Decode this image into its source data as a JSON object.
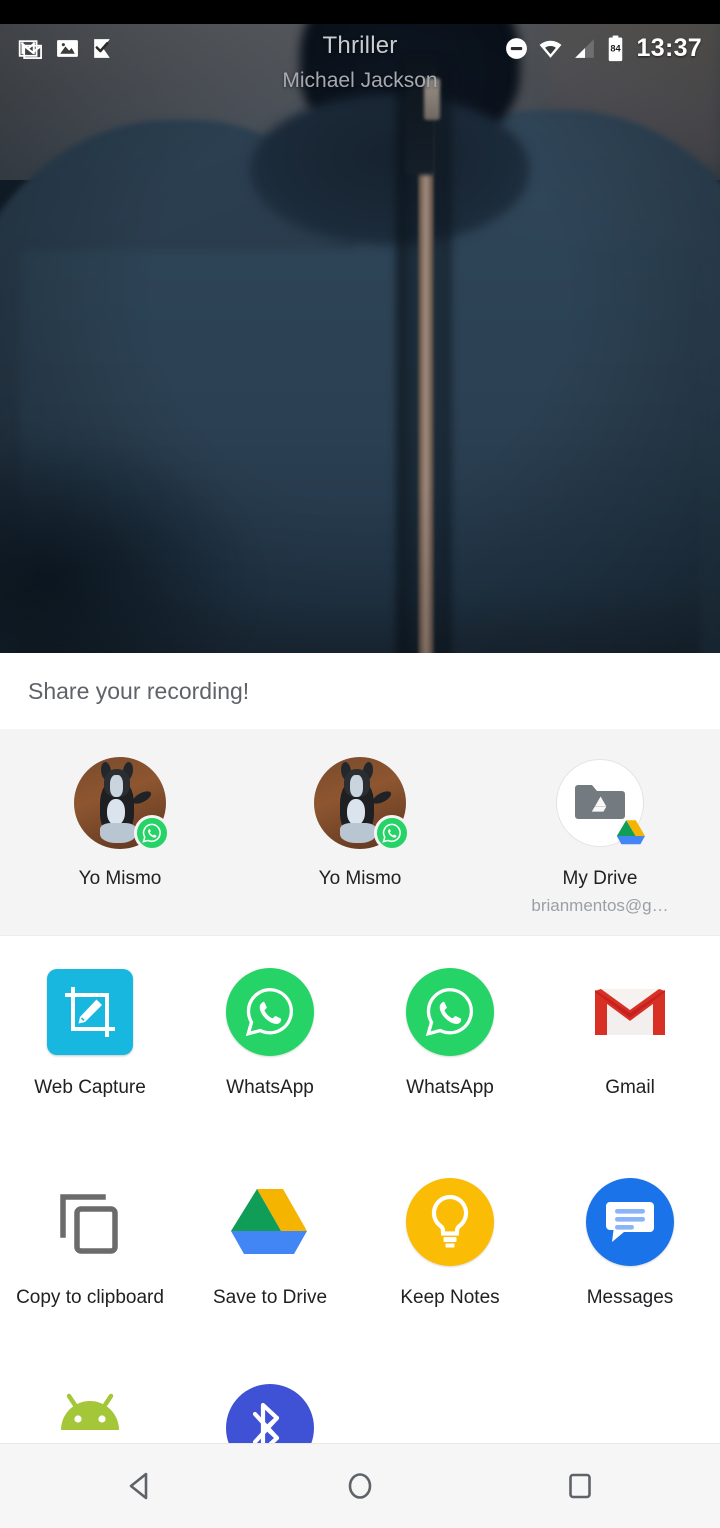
{
  "status_bar": {
    "time": "13:37",
    "battery_level": "84",
    "left_icons": [
      {
        "name": "gmail-notification-icon",
        "glyph": "M"
      },
      {
        "name": "photo-notification-icon",
        "glyph": "image"
      },
      {
        "name": "tasks-notification-icon",
        "glyph": "check-flag"
      }
    ],
    "right_icons": [
      {
        "name": "do-not-disturb-icon"
      },
      {
        "name": "wifi-icon"
      },
      {
        "name": "cellular-signal-icon"
      },
      {
        "name": "battery-icon"
      }
    ]
  },
  "video": {
    "title": "Thriller",
    "artist": "Michael Jackson"
  },
  "share_sheet": {
    "title": "Share your recording!",
    "direct_share": [
      {
        "label": "Yo Mismo",
        "sub": "",
        "icon": "contact-avatar-dog",
        "badge": "whatsapp-badge-icon"
      },
      {
        "label": "Yo Mismo",
        "sub": "",
        "icon": "contact-avatar-dog",
        "badge": "whatsapp-badge-icon"
      },
      {
        "label": "My Drive",
        "sub": "brianmentos@g…",
        "icon": "drive-folder-icon",
        "badge": "google-drive-badge-icon"
      }
    ],
    "app_rows": [
      [
        {
          "label": "Web Capture",
          "icon": "web-capture-icon"
        },
        {
          "label": "WhatsApp",
          "icon": "whatsapp-icon"
        },
        {
          "label": "WhatsApp",
          "icon": "whatsapp-icon"
        },
        {
          "label": "Gmail",
          "icon": "gmail-icon"
        }
      ],
      [
        {
          "label": "Copy to clipboard",
          "icon": "copy-to-clipboard-icon"
        },
        {
          "label": "Save to Drive",
          "icon": "google-drive-icon"
        },
        {
          "label": "Keep Notes",
          "icon": "google-keep-icon"
        },
        {
          "label": "Messages",
          "icon": "google-messages-icon"
        }
      ],
      [
        {
          "label": "",
          "icon": "android-beam-icon"
        },
        {
          "label": "",
          "icon": "bluetooth-icon"
        }
      ]
    ]
  },
  "nav_bar": {
    "back": "back-button",
    "home": "home-button",
    "recents": "recents-button"
  },
  "colors": {
    "whatsapp_green": "#25d366",
    "webcapture_cyan": "#18b7e0",
    "keep_yellow": "#fbbc05",
    "messages_blue": "#1a73e8",
    "gmail_red": "#d93025",
    "drive_blue": "#4285f4",
    "drive_green": "#0f9d58",
    "drive_yellow": "#f4b400",
    "sheet_gray": "#f4f4f4",
    "title_gray": "#5f6368"
  }
}
